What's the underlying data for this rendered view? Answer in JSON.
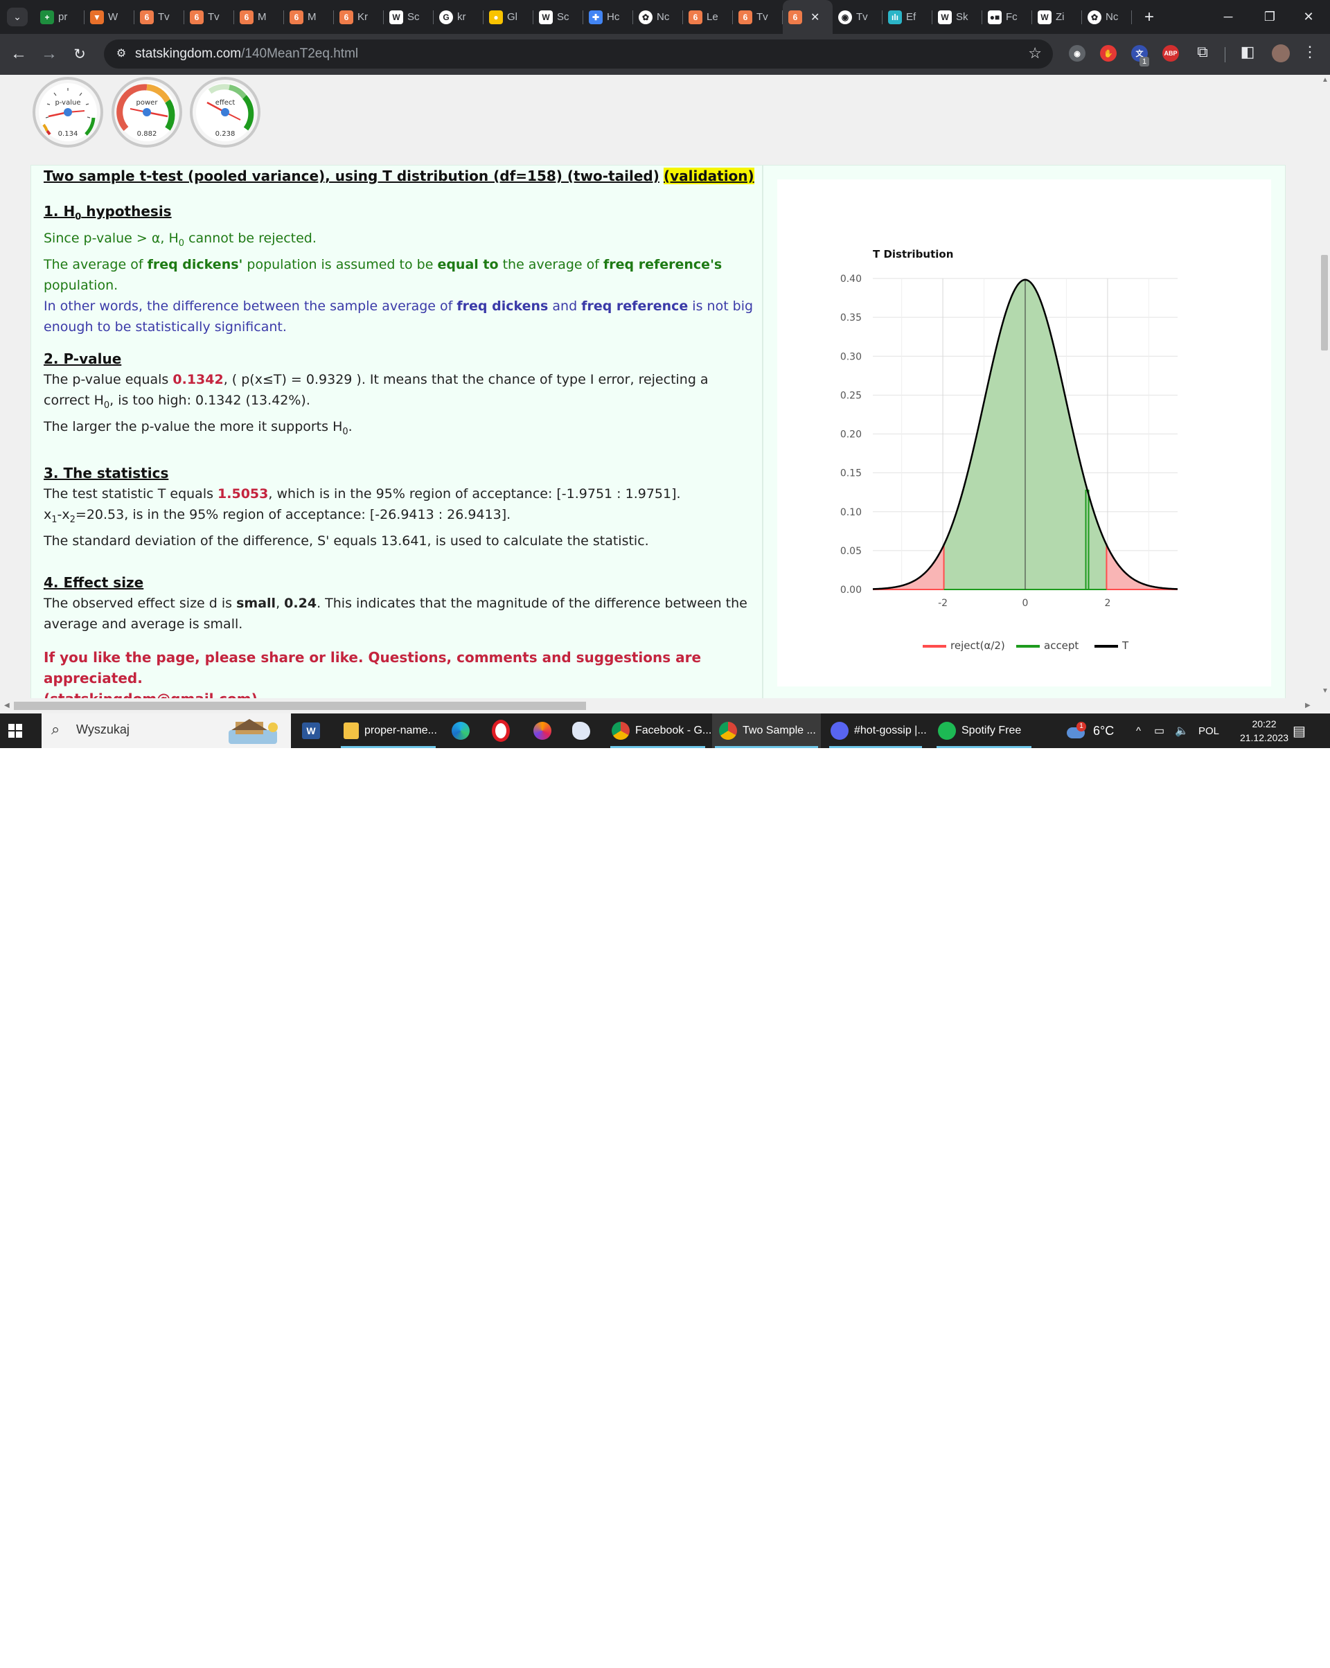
{
  "browser": {
    "tabs": [
      {
        "label": "pr",
        "icon": "sheets-icon",
        "color": "#1e8e3e",
        "glyph": "+"
      },
      {
        "label": "W",
        "icon": "bookmark-icon",
        "color": "#e8702a",
        "glyph": "▼"
      },
      {
        "label": "Tv",
        "icon": "statskingdom-icon",
        "color": "#ef7c4a",
        "glyph": "6"
      },
      {
        "label": "Tv",
        "icon": "statskingdom-icon",
        "color": "#ef7c4a",
        "glyph": "6"
      },
      {
        "label": "M",
        "icon": "statskingdom-icon",
        "color": "#ef7c4a",
        "glyph": "6"
      },
      {
        "label": "M",
        "icon": "statskingdom-icon",
        "color": "#ef7c4a",
        "glyph": "6"
      },
      {
        "label": "Kr",
        "icon": "statskingdom-icon",
        "color": "#ef7c4a",
        "glyph": "6"
      },
      {
        "label": "Sc",
        "icon": "wikipedia-icon",
        "color": "#ffffff",
        "glyph": "W"
      },
      {
        "label": "kr",
        "icon": "google-icon",
        "color": "#ffffff",
        "glyph": "G"
      },
      {
        "label": "Gl",
        "icon": "globe-icon",
        "color": "#f9c300",
        "glyph": "●"
      },
      {
        "label": "Sc",
        "icon": "wikipedia-icon",
        "color": "#ffffff",
        "glyph": "W"
      },
      {
        "label": "Hc",
        "icon": "puzzle-icon",
        "color": "#4285f4",
        "glyph": "✚"
      },
      {
        "label": "Nc",
        "icon": "chatgpt-icon",
        "color": "#ffffff",
        "glyph": "✿"
      },
      {
        "label": "Le",
        "icon": "statskingdom-icon",
        "color": "#ef7c4a",
        "glyph": "6"
      },
      {
        "label": "Tv",
        "icon": "statskingdom-icon",
        "color": "#ef7c4a",
        "glyph": "6"
      },
      {
        "label": "",
        "icon": "statskingdom-icon",
        "color": "#ef7c4a",
        "glyph": "6",
        "active": true
      },
      {
        "label": "Tv",
        "icon": "shield-icon",
        "color": "#ffffff",
        "glyph": "◉"
      },
      {
        "label": "Ef",
        "icon": "bar-chart-icon",
        "color": "#2bb5c8",
        "glyph": "ılı"
      },
      {
        "label": "Sk",
        "icon": "wikipedia-icon",
        "color": "#ffffff",
        "glyph": "W"
      },
      {
        "label": "Fc",
        "icon": "camera-icon",
        "color": "#ffffff",
        "glyph": "●■"
      },
      {
        "label": "Zi",
        "icon": "wikipedia-icon",
        "color": "#ffffff",
        "glyph": "W"
      },
      {
        "label": "Nc",
        "icon": "chatgpt-icon",
        "color": "#ffffff",
        "glyph": "✿"
      }
    ],
    "new_tab_label": "+",
    "url_host": "statskingdom.com",
    "url_path": "/140MeanT2eq.html",
    "extension_badge": "1",
    "abp_label": "ABP"
  },
  "gauges": [
    {
      "label": "p-value",
      "value": "0.134"
    },
    {
      "label": "power",
      "value": "0.882"
    },
    {
      "label": "effect",
      "value": "0.238"
    }
  ],
  "report": {
    "title": "Two sample t-test (pooled variance), using T distribution (df=158) (two-tailed)",
    "validation": "(validation)",
    "s1_title_pre": "1. H",
    "s1_title_sub": "0",
    "s1_title_post": " hypothesis",
    "s1_line1_pre": "Since p-value > α, H",
    "s1_line1_sub": "0",
    "s1_line1_post": " cannot be rejected.",
    "s1_line2_a": "The average of ",
    "s1_line2_b": "freq dickens'",
    "s1_line2_c": " population is assumed to be ",
    "s1_line2_d": "equal to",
    "s1_line2_e": " the average of ",
    "s1_line2_f": "freq reference's",
    "s1_line2_g": " population.",
    "s1_line3_a": "In other words, the difference between the sample average of ",
    "s1_line3_b": "freq dickens",
    "s1_line3_c": " and ",
    "s1_line3_d": "freq reference",
    "s1_line3_e": " is not big enough to be statistically significant.",
    "s2_title": "2. P-value",
    "s2_line1_a": "The p-value equals ",
    "s2_line1_b": "0.1342",
    "s2_line1_c": ", ( p(x≤T) = 0.9329 ). It means that the chance of type I error, rejecting a correct H",
    "s2_line1_sub": "0",
    "s2_line1_d": ", is too high: 0.1342 (13.42%).",
    "s2_line2_a": "The larger the p-value the more it supports H",
    "s2_line2_sub": "0",
    "s2_line2_b": ".",
    "s3_title": "3. The statistics",
    "s3_line1_a": "The test statistic T equals ",
    "s3_line1_b": "1.5053",
    "s3_line1_c": ", which is in the 95% region of acceptance: [-1.9751 : 1.9751].",
    "s3_line2_a": "x",
    "s3_line2_sub1": "1",
    "s3_line2_b": "-x",
    "s3_line2_sub2": "2",
    "s3_line2_c": "=20.53, is in the 95% region of acceptance: [-26.9413 : 26.9413].",
    "s3_line3": "The standard deviation of the difference, S' equals 13.641, is used to calculate the statistic.",
    "s4_title": "4. Effect size",
    "s4_line1_a": "The observed effect size d is ",
    "s4_line1_b": "small",
    "s4_line1_c": ", ",
    "s4_line1_d": "0.24",
    "s4_line1_e": ". This indicates that the magnitude of the difference between the average and average is small.",
    "call_1": "If you like the page, please share or like. Questions, comments and suggestions are appreciated.",
    "call_2": "(statskingdom@gmail.com)"
  },
  "chart_data": {
    "type": "area",
    "title": "T Distribution",
    "xlabel": "",
    "ylabel": "",
    "xlim": [
      -3.7,
      3.7
    ],
    "ylim": [
      0,
      0.4
    ],
    "x_ticks": [
      -2,
      0,
      2
    ],
    "y_ticks": [
      0.0,
      0.05,
      0.1,
      0.15,
      0.2,
      0.25,
      0.3,
      0.35,
      0.4
    ],
    "df": 158,
    "critical_values": [
      -1.9751,
      1.9751
    ],
    "t_statistic": 1.5053,
    "grid": true,
    "legend_position": "bottom",
    "series": [
      {
        "name": "reject(α/2)",
        "color": "#ff4d4d",
        "fill": "#f9b5b5"
      },
      {
        "name": "accept",
        "color": "#1e9b1e",
        "fill": "#b3d9ad"
      },
      {
        "name": "T",
        "color": "#000000"
      }
    ]
  },
  "taskbar": {
    "search_placeholder": "Wyszukaj",
    "apps": [
      {
        "label": "proper-name...",
        "icon": "folder-icon"
      },
      {
        "label": "Facebook - G...",
        "icon": "chrome-icon"
      },
      {
        "label": "Two Sample ...",
        "icon": "chrome-icon"
      },
      {
        "label": "#hot-gossip |...",
        "icon": "discord-icon"
      },
      {
        "label": "Spotify Free",
        "icon": "spotify-icon"
      }
    ],
    "temperature": "6°C",
    "weather_badge": "1",
    "language": "POL",
    "time": "20:22",
    "date": "21.12.2023"
  }
}
